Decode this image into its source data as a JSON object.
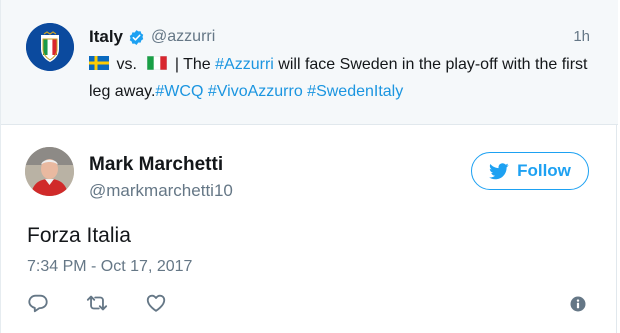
{
  "parent_tweet": {
    "author_name": "Italy",
    "handle": "@azzurri",
    "time": "1h",
    "text_vs": "vs.",
    "text_mid": "| The",
    "hashtag_azzurri": "#Azzurri",
    "text_rest": "will face Sweden in the play-off with the first leg away.",
    "hashtags_end": [
      "#WCQ",
      "#VivoAzzurro",
      "#SwedenItaly"
    ]
  },
  "tweet": {
    "author_name": "Mark Marchetti",
    "handle": "@markmarchetti10",
    "follow_label": "Follow",
    "text": "Forza Italia",
    "timestamp": "7:34 PM - Oct 17, 2017"
  },
  "icons": [
    "reply-icon",
    "retweet-icon",
    "like-icon",
    "info-icon",
    "twitter-bird-icon",
    "verified-badge-icon"
  ],
  "colors": {
    "twitter_blue": "#1da1f2",
    "hashtag_blue": "#1b95e0",
    "secondary_text": "#657786",
    "parent_background": "#f5f8fa"
  }
}
